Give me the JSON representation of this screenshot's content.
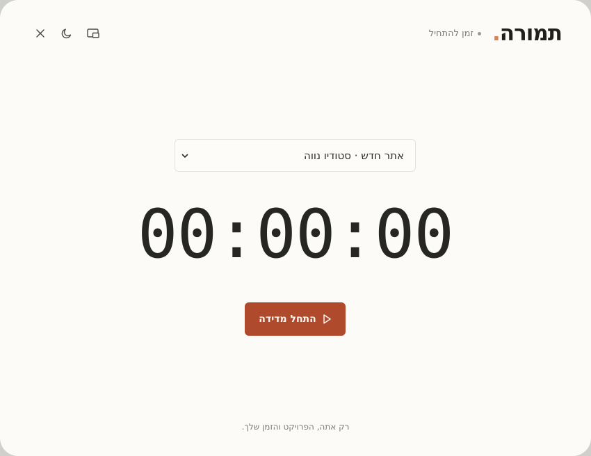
{
  "app": {
    "logo_text": "תמורה",
    "logo_dot": ".",
    "status_text": "זמן להתחיל"
  },
  "icons": {
    "close": "close-icon",
    "theme": "moon-icon",
    "pip": "picture-in-picture-icon",
    "chevron": "chevron-down-icon",
    "play": "play-icon"
  },
  "project_select": {
    "value": "אתר חדש · סטודיו נווה"
  },
  "timer": {
    "display": "00:00:00"
  },
  "start_button": {
    "label": "התחל מדידה"
  },
  "footer": {
    "text": "רק אתה, הפרויקט והזמן שלך."
  },
  "colors": {
    "accent": "#b04a2c",
    "logo_dot": "#d9824f",
    "background": "#fcfbf7"
  }
}
